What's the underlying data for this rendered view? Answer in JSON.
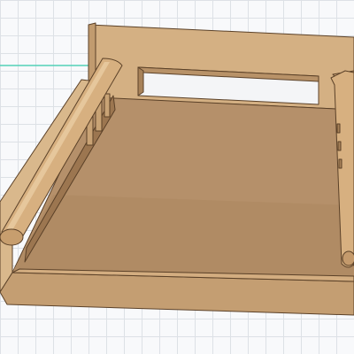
{
  "viewport": {
    "background_color": "#f8f9fb",
    "grid_color": "#dde1e6",
    "x_axis_color": "#52d1b8"
  },
  "model": {
    "wood_light": "#d8b58a",
    "wood_mid": "#c49a6c",
    "wood_floor": "#b08a62",
    "wood_dark": "#8f6a47",
    "edge_color": "#5b4128"
  }
}
